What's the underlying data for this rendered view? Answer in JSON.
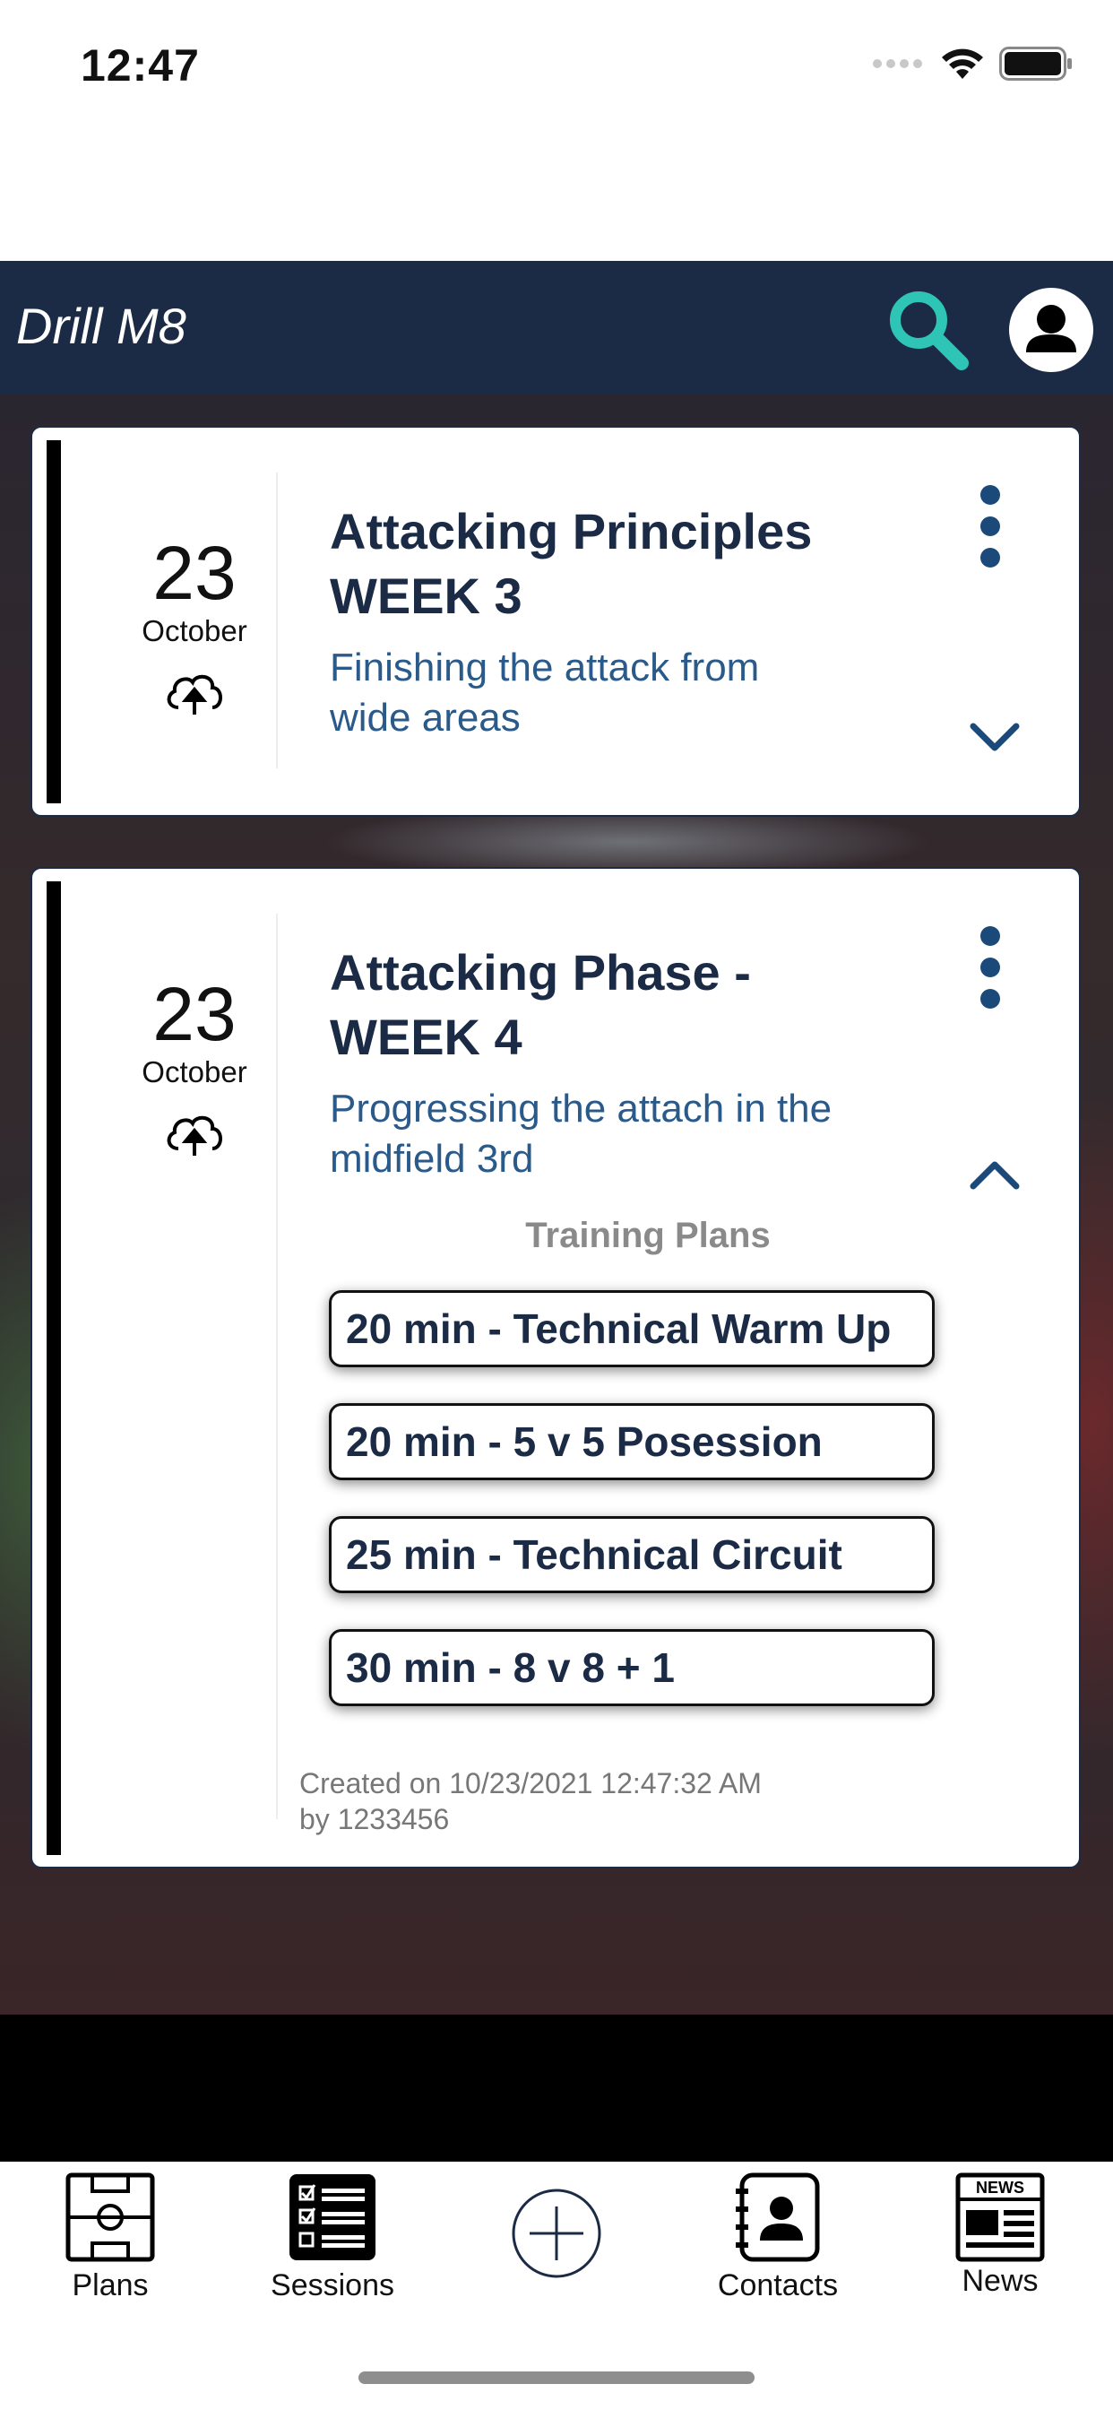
{
  "status_bar": {
    "time": "12:47"
  },
  "header": {
    "title": "Drill M8"
  },
  "cards": [
    {
      "day": "23",
      "month": "October",
      "title_line1": "Attacking Principles",
      "title_line2": "WEEK 3",
      "subtitle_line1": "Finishing the attack from",
      "subtitle_line2": "wide areas",
      "expanded": false
    },
    {
      "day": "23",
      "month": "October",
      "title_line1": "Attacking Phase -",
      "title_line2": "WEEK 4",
      "subtitle_line1": "Progressing the attach in the",
      "subtitle_line2": "midfield 3rd",
      "expanded": true,
      "plans_heading": "Training Plans",
      "plans": [
        "20 min - Technical Warm Up",
        "20 min - 5 v 5 Posession",
        "25 min - Technical Circuit",
        "30 min - 8 v 8 + 1"
      ],
      "created_line1": "Created on 10/23/2021 12:47:32 AM",
      "created_line2": "by 1233456"
    }
  ],
  "tabs": {
    "plans": "Plans",
    "sessions": "Sessions",
    "contacts": "Contacts",
    "news": "News",
    "news_badge": "NEWS"
  },
  "colors": {
    "header_bg": "#1b2b46",
    "accent_teal": "#2ec4b6",
    "title_navy": "#1b2b46",
    "subtitle_blue": "#2a5a8a"
  }
}
